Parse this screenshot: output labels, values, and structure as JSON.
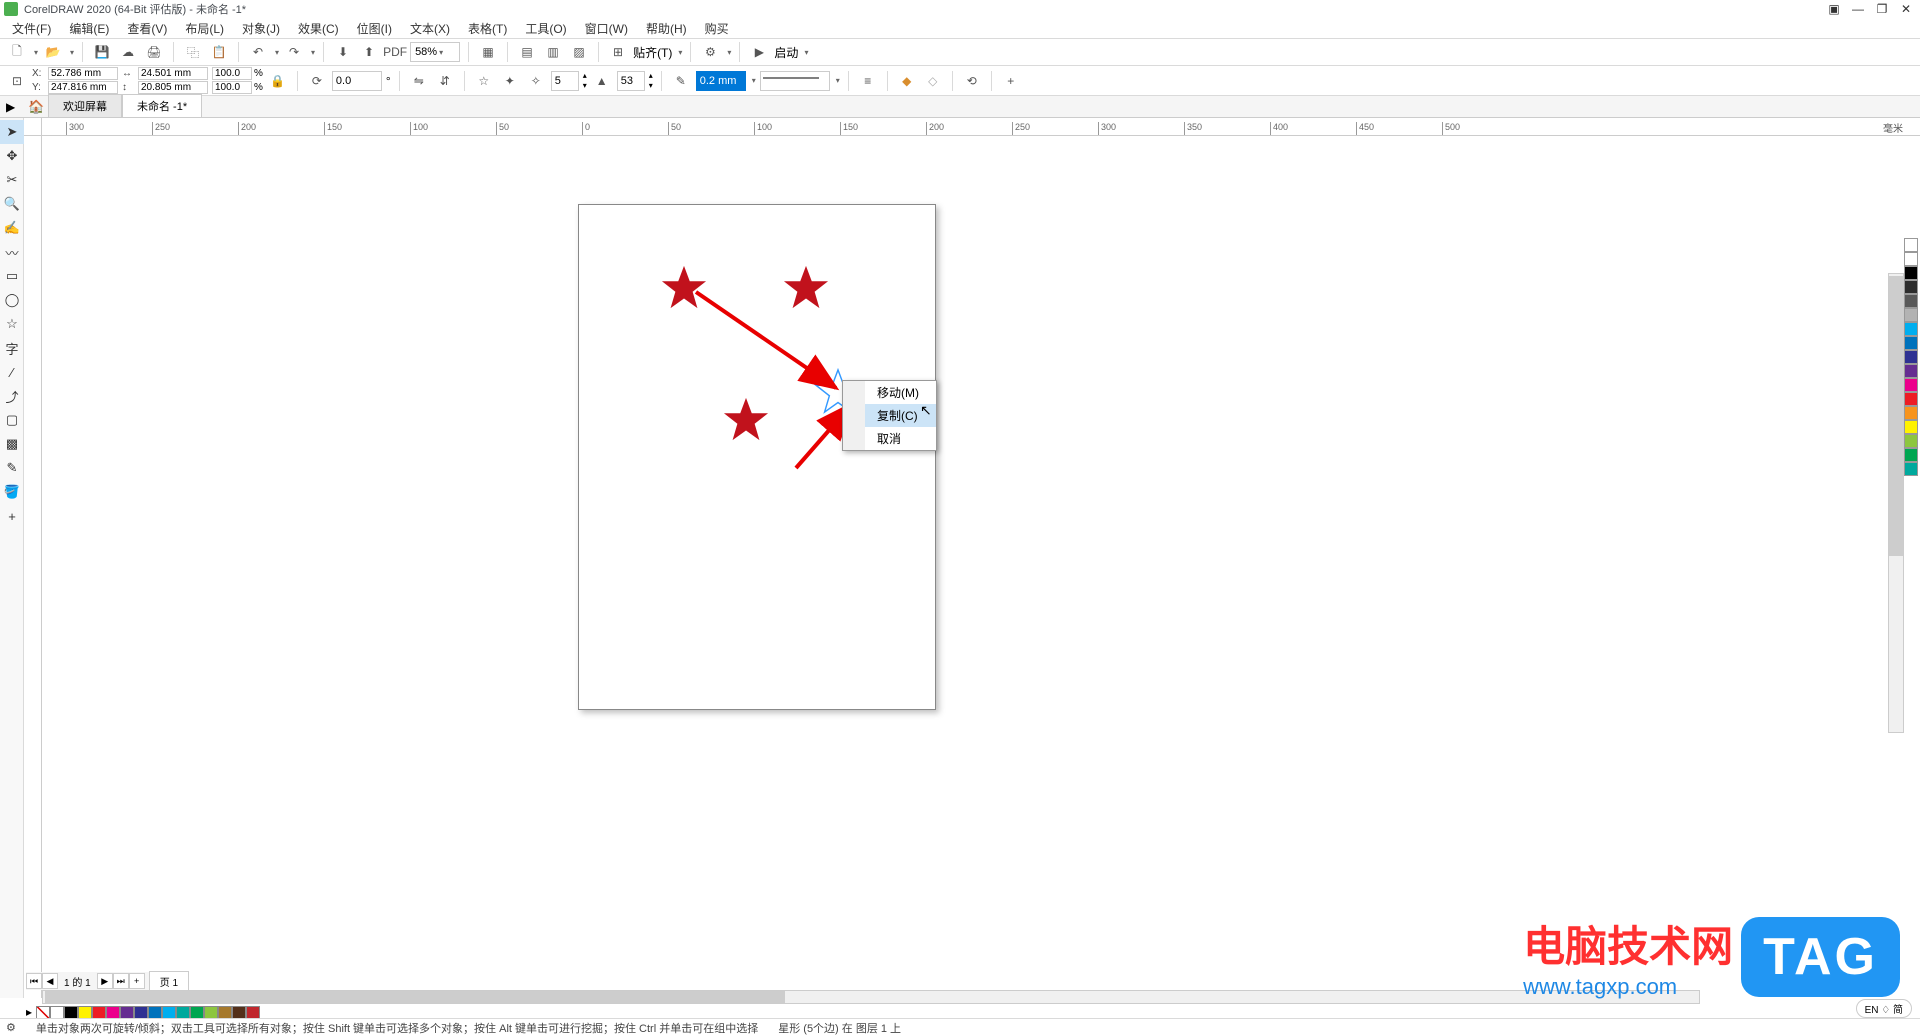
{
  "window": {
    "title": "CorelDRAW 2020 (64-Bit 评估版) - 未命名 -1*"
  },
  "menu": {
    "file": "文件(F)",
    "edit": "编辑(E)",
    "view": "查看(V)",
    "layout": "布局(L)",
    "object": "对象(J)",
    "effects": "效果(C)",
    "bitmap": "位图(I)",
    "text": "文本(X)",
    "table": "表格(T)",
    "tools": "工具(O)",
    "window": "窗口(W)",
    "help": "帮助(H)",
    "buy": "购买"
  },
  "toolbar1": {
    "zoom": "58%",
    "paste": "贴齐(T)",
    "launch": "启动"
  },
  "toolbar2": {
    "x_label": "X:",
    "y_label": "Y:",
    "x_val": "52.786 mm",
    "y_val": "247.816 mm",
    "w_val": "24.501 mm",
    "h_val": "20.805 mm",
    "scale_x": "100.0",
    "scale_y": "100.0",
    "percent": "%",
    "rotation": "0.0",
    "deg": "°",
    "points": "5",
    "sharpness": "53",
    "outline": "0.2 mm"
  },
  "tabs": {
    "welcome": "欢迎屏幕",
    "doc1": "未命名 -1*"
  },
  "ruler": {
    "unit": "毫米",
    "h_ticks": [
      "300",
      "250",
      "200",
      "150",
      "100",
      "50",
      "0",
      "50",
      "100",
      "150",
      "200",
      "250",
      "300",
      "350",
      "400",
      "450",
      "500"
    ]
  },
  "context_menu": {
    "move": "移动(M)",
    "copy": "复制(C)",
    "cancel": "取消"
  },
  "page_nav": {
    "info": "1 的 1",
    "page1": "页 1"
  },
  "status": {
    "hint": "单击对象两次可旋转/倾斜；双击工具可选择所有对象；按住 Shift 键单击可选择多个对象；按住 Alt 键单击可进行挖掘；按住 Ctrl 并单击可在组中选择",
    "object_info": "星形 (5个边) 在 图层 1 上",
    "lang": "EN ♢ 简"
  },
  "palette_colors": [
    "#ffffff",
    "#000000",
    "#2d2d2d",
    "#595959",
    "#b3b3b3",
    "#00aeef",
    "#0072bc",
    "#2e3192",
    "#662d91",
    "#ec008c",
    "#ed1c24",
    "#f7941d",
    "#fff200",
    "#8dc63f",
    "#00a651",
    "#00a99d"
  ],
  "bottom_colors": [
    "#ffffff",
    "#000000",
    "#fff200",
    "#ed1c24",
    "#ec008c",
    "#662d91",
    "#2e3192",
    "#0072bc",
    "#00aeef",
    "#00a99d",
    "#00a651",
    "#8dc63f",
    "#a6792c",
    "#54301a",
    "#c0272d"
  ],
  "watermark": {
    "line1": "电脑技术网",
    "line2": "www.tagxp.com",
    "tag": "TAG"
  }
}
